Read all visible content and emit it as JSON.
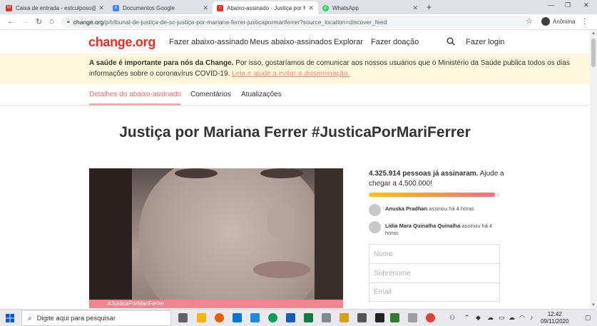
{
  "browser": {
    "tabs": [
      {
        "title": "Caixa de entrada - estculposo@...",
        "color": "#d93025",
        "active": false
      },
      {
        "title": "Documentos Google",
        "color": "#4285f4",
        "active": false
      },
      {
        "title": "Abaixo-assinado · Justiça por Ma...",
        "color": "#ec2c22",
        "active": true
      },
      {
        "title": "WhatsApp",
        "color": "#25d366",
        "active": false
      }
    ],
    "url_domain": "change.org",
    "url_path": "/p/tribunal-de-justiça-de-sc-justiça-por-mariana-ferrer-justicapormariferrer?source_location=discover_feed",
    "profile_label": "Anônima"
  },
  "site": {
    "logo": "change.org",
    "nav": {
      "start": "Fazer abaixo-assinado",
      "mine": "Meus abaixo-assinados",
      "explore": "Explorar",
      "donate": "Fazer doação",
      "login": "Fazer login"
    }
  },
  "banner": {
    "bold": "A saúde é importante para nós da Change.",
    "text": " Por isso, gostaríamos de comunicar aos nossos usuários que o Ministério da Saúde publica todos os dias informações sobre o coronavírus COVID-19. ",
    "link": "Leia e ajude a evitar a disseminação."
  },
  "subtabs": {
    "details": "Detalhes do abaixo-assinado",
    "comments": "Comentários",
    "updates": "Atualizações"
  },
  "petition": {
    "title": "Justiça por Mariana Ferrer #JusticaPorMariFerrer",
    "image_tag": "#JusticaPorMariFerrer",
    "signed_count": "4.325.914 pessoas já assinaram.",
    "goal_text": " Ajude a chegar a 4.500.000!",
    "progress_fraction": 0.96,
    "signers": [
      {
        "name": "Anuska Pradhan",
        "action": " assinou há 4 horas"
      },
      {
        "name": "Lídia Mara Quinalha Quinalha",
        "action": " assinou há 4 horas"
      }
    ],
    "form": {
      "first_name_placeholder": "Nome",
      "last_name_placeholder": "Sobrenome",
      "email_placeholder": "Email"
    }
  },
  "taskbar": {
    "search_placeholder": "Digite aqui para pesquisar",
    "time": "12:42",
    "date": "09/11/2020"
  }
}
